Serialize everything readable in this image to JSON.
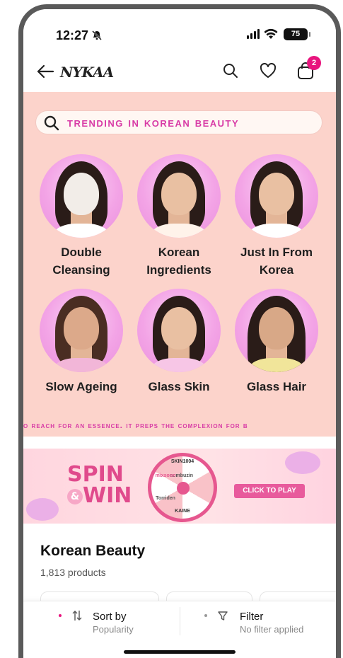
{
  "status_bar": {
    "time": "12:27",
    "battery": "75"
  },
  "header": {
    "logo": "NYKAA",
    "cart_count": "2"
  },
  "trending": {
    "title": "Trending in Korean Beauty",
    "categories": [
      {
        "label_line1": "Double",
        "label_line2": "Cleansing"
      },
      {
        "label_line1": "Korean",
        "label_line2": "Ingredients"
      },
      {
        "label_line1": "Just In From",
        "label_line2": "Korea"
      },
      {
        "label_line1": "Slow Ageing",
        "label_line2": ""
      },
      {
        "label_line1": "Glass Skin",
        "label_line2": ""
      },
      {
        "label_line1": "Glass Hair",
        "label_line2": ""
      }
    ],
    "ticker": "o reach for an essence. It preps the complexion for b"
  },
  "spin_banner": {
    "title_top": "SPIN",
    "amp": "&",
    "title_bottom": "WIN",
    "wheel_brand": "SKIN1004",
    "wheel_segments": [
      "numbuzin",
      "KAINE",
      "Torriden",
      "mixsoon"
    ],
    "cta": "CLICK TO PLAY"
  },
  "listing": {
    "title": "Korean Beauty",
    "count": "1,813 products"
  },
  "bottom_bar": {
    "sort_label": "Sort by",
    "sort_value": "Popularity",
    "filter_label": "Filter",
    "filter_value": "No filter applied"
  },
  "colors": {
    "accent": "#e8157e",
    "trending_bg": "#fcd3cb",
    "trending_text": "#d83ba6"
  }
}
